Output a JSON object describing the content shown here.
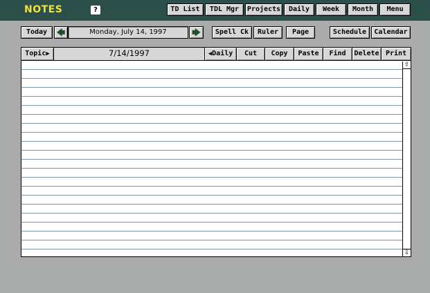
{
  "app": {
    "title": "NOTES",
    "help_label": "?"
  },
  "top_nav": {
    "td_list": "TD List",
    "tdl_mgr": "TDL Mgr",
    "projects": "Projects",
    "daily": "Daily",
    "week": "Week",
    "month": "Month",
    "menu": "Menu"
  },
  "date_bar": {
    "today": "Today",
    "prev_arrow": "🡄",
    "next_arrow": "🡆",
    "current_date": "Monday, July 14, 1997"
  },
  "tools": {
    "spell_check": "Spell Ck",
    "ruler": "Ruler",
    "page": "Page",
    "schedule": "Schedule",
    "calendar": "Calendar"
  },
  "note_toolbar": {
    "topic": "Topic",
    "topic_arrow": "▶",
    "note_date": "7/14/1997",
    "daily_arrow": "◀",
    "daily": "Daily",
    "cut": "Cut",
    "copy": "Copy",
    "paste": "Paste",
    "find": "Find",
    "delete": "Delete",
    "print": "Print"
  },
  "scroll": {
    "up_arrow": "⇧",
    "down_arrow": "⇩"
  },
  "colors": {
    "background": "#a9acab",
    "title_bar": "#2c4f49",
    "title_text": "#f2e33a",
    "button_face": "#d7d7d7",
    "rule_line": "#7f95a0"
  },
  "icons": [
    "help-icon",
    "arrow-left-icon",
    "arrow-right-icon",
    "triangle-right-icon",
    "triangle-left-icon",
    "scroll-up-icon",
    "scroll-down-icon"
  ]
}
